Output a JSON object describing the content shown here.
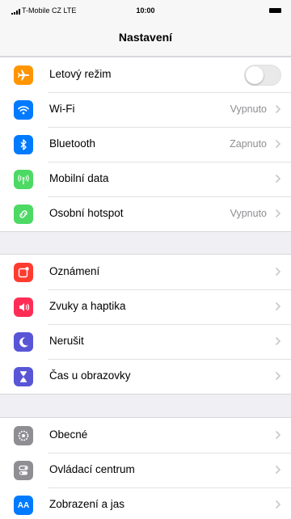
{
  "status_bar": {
    "carrier": "T-Mobile CZ  LTE",
    "time": "10:00"
  },
  "nav": {
    "title": "Nastavení"
  },
  "groups": [
    {
      "rows": [
        {
          "id": "airplane",
          "label": "Letový režim",
          "icon": "airplane-icon",
          "color": "#ff9500",
          "control": "toggle",
          "toggle_on": false
        },
        {
          "id": "wifi",
          "label": "Wi-Fi",
          "value": "Vypnuto",
          "icon": "wifi-icon",
          "color": "#007aff"
        },
        {
          "id": "bluetooth",
          "label": "Bluetooth",
          "value": "Zapnuto",
          "icon": "bluetooth-icon",
          "color": "#007aff"
        },
        {
          "id": "mobile-data",
          "label": "Mobilní data",
          "value": "",
          "icon": "antenna-icon",
          "color": "#4cd964"
        },
        {
          "id": "hotspot",
          "label": "Osobní hotspot",
          "value": "Vypnuto",
          "icon": "hotspot-link-icon",
          "color": "#4cd964"
        }
      ]
    },
    {
      "rows": [
        {
          "id": "notifications",
          "label": "Oznámení",
          "icon": "notifications-icon",
          "color": "#ff3b30"
        },
        {
          "id": "sounds",
          "label": "Zvuky a haptika",
          "icon": "speaker-icon",
          "color": "#ff2d55"
        },
        {
          "id": "dnd",
          "label": "Nerušit",
          "icon": "moon-icon",
          "color": "#5856d6"
        },
        {
          "id": "screen-time",
          "label": "Čas u obrazovky",
          "icon": "hourglass-icon",
          "color": "#5856d6"
        }
      ]
    },
    {
      "rows": [
        {
          "id": "general",
          "label": "Obecné",
          "icon": "gear-icon",
          "color": "#8e8e93"
        },
        {
          "id": "control-center",
          "label": "Ovládací centrum",
          "icon": "control-center-icon",
          "color": "#8e8e93"
        },
        {
          "id": "display",
          "label": "Zobrazení a jas",
          "icon": "AA-icon",
          "icon_text": "AA",
          "color": "#007aff"
        }
      ]
    }
  ]
}
